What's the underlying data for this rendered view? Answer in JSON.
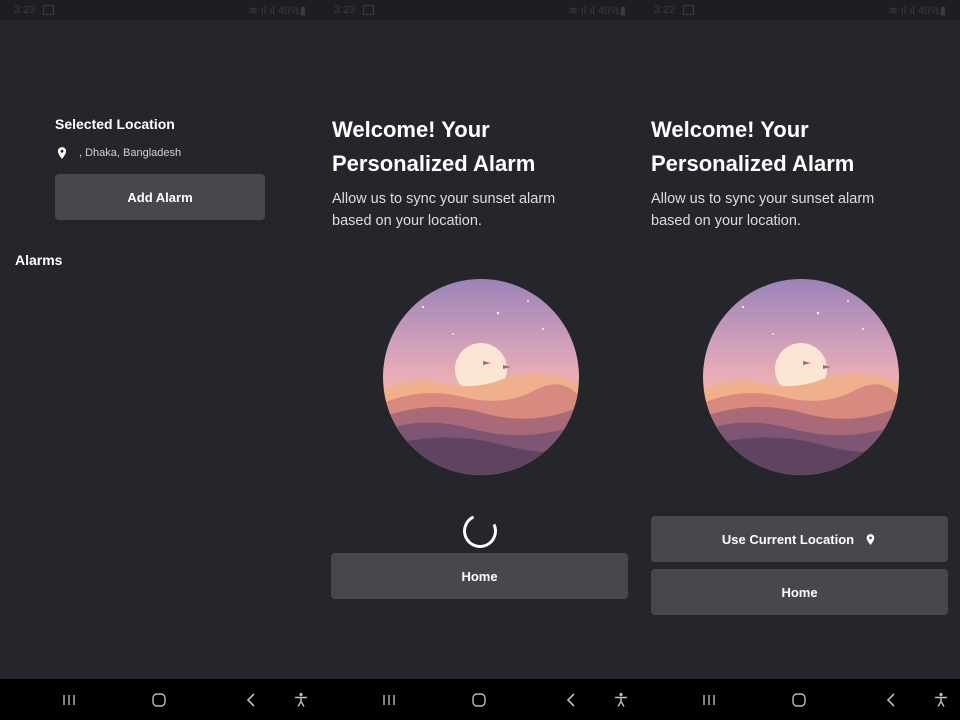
{
  "screens": [
    {
      "status_time": "3:23",
      "status_right": "40%",
      "selected_location_title": "Selected Location",
      "location_text": ", Dhaka, Bangladesh",
      "add_alarm_label": "Add Alarm",
      "alarms_heading": "Alarms"
    },
    {
      "status_time": "3:23",
      "status_right": "40%",
      "welcome_line1": "Welcome! Your",
      "welcome_line2": "Personalized Alarm",
      "desc_line1": "Allow us to sync your sunset alarm",
      "desc_line2": "based on your location.",
      "home_label": "Home"
    },
    {
      "status_time": "3:22",
      "status_right": "40%",
      "welcome_line1": "Welcome! Your",
      "welcome_line2": "Personalized Alarm",
      "desc_line1": "Allow us to sync your sunset alarm",
      "desc_line2": "based on your location.",
      "use_location_label": "Use Current Location",
      "home_label": "Home"
    }
  ],
  "colors": {
    "background": "#25262b",
    "button": "#47484c",
    "text": "#ffffff"
  },
  "icons": [
    "location-pin-icon",
    "recents-icon",
    "home-nav-icon",
    "back-icon",
    "accessibility-icon",
    "loading-spinner"
  ]
}
